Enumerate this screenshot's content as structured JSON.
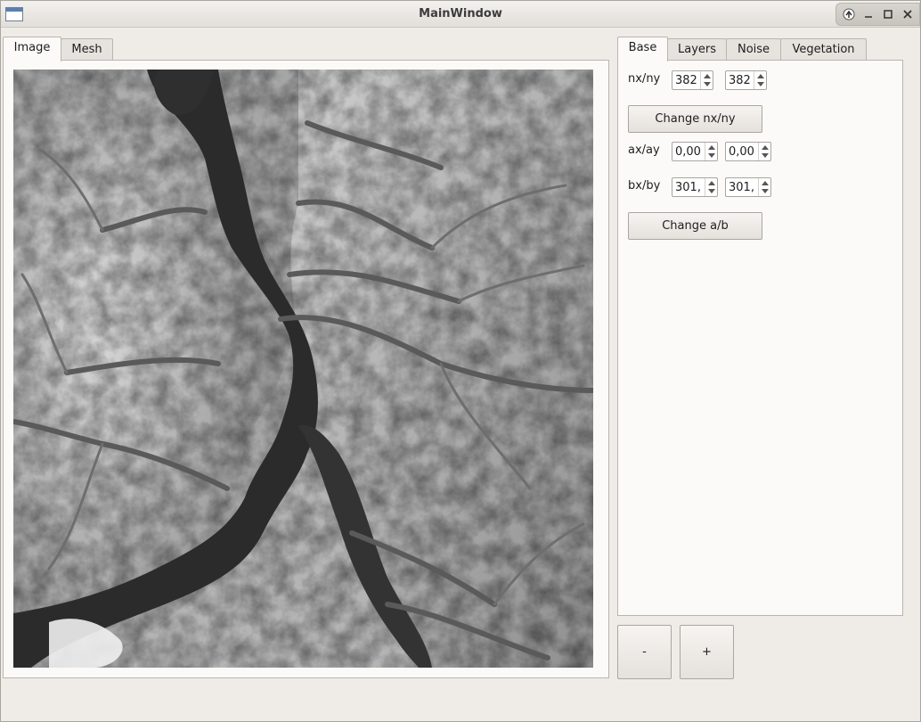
{
  "window": {
    "title": "MainWindow"
  },
  "left_tabs": [
    "Image",
    "Mesh"
  ],
  "right_tabs": [
    "Base",
    "Layers",
    "Noise",
    "Vegetation"
  ],
  "base": {
    "nxny_label": "nx/ny",
    "nx": "382",
    "ny": "382",
    "change_nxny": "Change nx/ny",
    "axay_label": "ax/ay",
    "ax": "0,00",
    "ay": "0,00",
    "bxby_label": "bx/by",
    "bx": "301,",
    "by": "301,",
    "change_ab": "Change a/b"
  },
  "zoom": {
    "minus": "-",
    "plus": "+"
  },
  "icons": {
    "restore": "up-arrow-icon",
    "minimize": "minimize-icon",
    "maximize": "maximize-icon",
    "close": "close-icon"
  }
}
